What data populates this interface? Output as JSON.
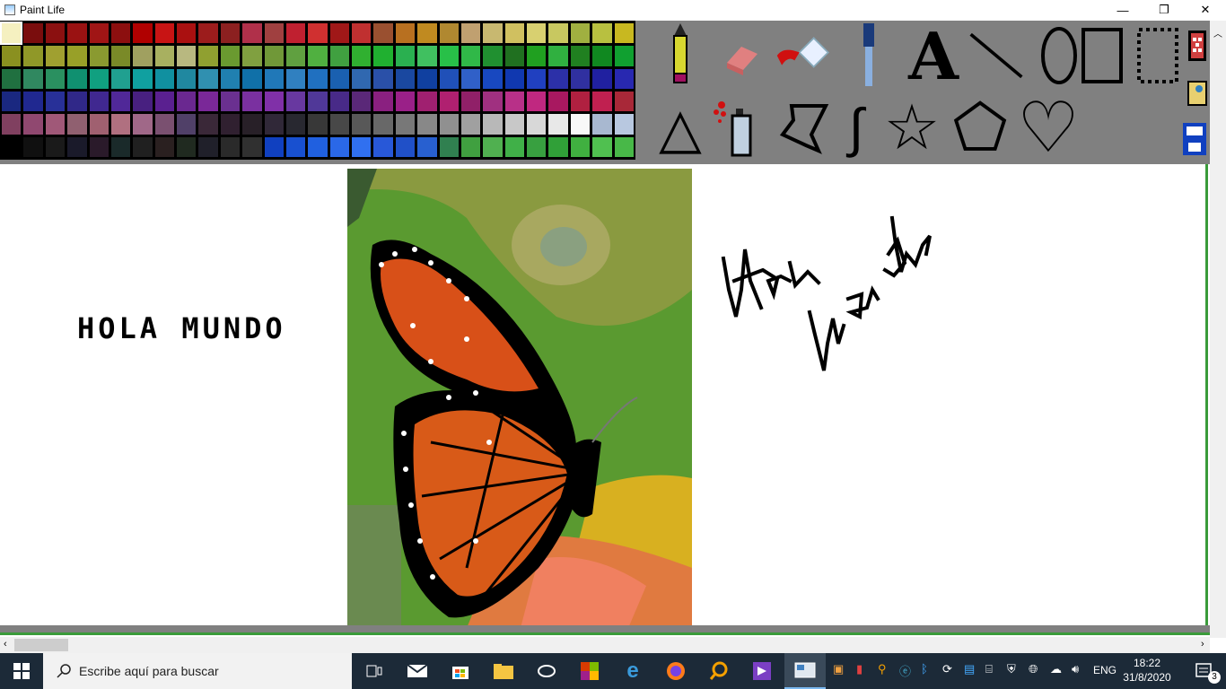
{
  "window": {
    "title": "Paint Life",
    "minimize_glyph": "—",
    "restore_glyph": "❐",
    "close_glyph": "✕"
  },
  "palette": {
    "colors": [
      "#f5f0c0",
      "#7a0d0d",
      "#8b1010",
      "#9a1212",
      "#a01515",
      "#8c0f0f",
      "#b00000",
      "#c81414",
      "#aa1010",
      "#9c1c1c",
      "#8c2020",
      "#b0304a",
      "#a04040",
      "#c02030",
      "#d03030",
      "#a01818",
      "#c03030",
      "#9a5030",
      "#b87020",
      "#c08a20",
      "#b08830",
      "#c0a070",
      "#c8b870",
      "#d0c060",
      "#d8d070",
      "#c8c860",
      "#a0b040",
      "#b8c040",
      "#c8b820",
      "#8a9020",
      "#909828",
      "#a0a030",
      "#98a028",
      "#8a9a30",
      "#7a8a28",
      "#a0a060",
      "#a8b060",
      "#b8b880",
      "#90a030",
      "#6a9a30",
      "#80a040",
      "#709838",
      "#60a040",
      "#50b040",
      "#40a040",
      "#30b030",
      "#20b030",
      "#2ab050",
      "#40c060",
      "#28c048",
      "#30b848",
      "#209030",
      "#207020",
      "#20a020",
      "#30b040",
      "#208020",
      "#108820",
      "#10a030",
      "#207040",
      "#308860",
      "#2a9060",
      "#109070",
      "#10a080",
      "#20a090",
      "#10a0a0",
      "#1090a0",
      "#2088a0",
      "#3090b0",
      "#2080b0",
      "#1070a8",
      "#2078b8",
      "#3080c0",
      "#2070c0",
      "#1a60b0",
      "#3068b0",
      "#2a50a8",
      "#1a48a0",
      "#1040a0",
      "#2050b8",
      "#3060c8",
      "#1848c0",
      "#1038b0",
      "#2040c0",
      "#2c30a8",
      "#3030a0",
      "#2020a0",
      "#2828b0",
      "#1a2880",
      "#202890",
      "#283098",
      "#302888",
      "#402890",
      "#502898",
      "#482080",
      "#5a2090",
      "#6a2890",
      "#7a2898",
      "#6a3090",
      "#7a30a0",
      "#8030a8",
      "#6838a0",
      "#503898",
      "#482a88",
      "#5a2878",
      "#8a2080",
      "#9a2088",
      "#a02070",
      "#b02070",
      "#902068",
      "#a03080",
      "#b83088",
      "#c02880",
      "#a81860",
      "#b02040",
      "#c02050",
      "#a82838",
      "#804060",
      "#904870",
      "#a05878",
      "#906070",
      "#a06070",
      "#b07080",
      "#a06888",
      "#7a5070",
      "#504068",
      "#3a2838",
      "#302030",
      "#282028",
      "#302838",
      "#282830",
      "#383838",
      "#484848",
      "#585858",
      "#686868",
      "#787878",
      "#888888",
      "#909090",
      "#a0a0a0",
      "#b8b8b8",
      "#c8c8c8",
      "#d8d8d8",
      "#e8e8e8",
      "#f8f8f8",
      "#a8b8d0",
      "#b8c8e0",
      "#000000",
      "#101010",
      "#1a1a1a",
      "#1a1a2a",
      "#2a1a2a",
      "#1a2a2a",
      "#202020",
      "#2a2020",
      "#202a20",
      "#20202a",
      "#2a2a2a",
      "#303030",
      "#1040c0",
      "#1850d0",
      "#2060e0",
      "#2a68e8",
      "#3070f0",
      "#2858d8",
      "#2050c8",
      "#2860d0",
      "#308050",
      "#40a040",
      "#50b050",
      "#40b048",
      "#38a040",
      "#30a038",
      "#40b040",
      "#50c050",
      "#48b848"
    ]
  },
  "tools": [
    {
      "name": "pencil-icon",
      "glyph": "✎"
    },
    {
      "name": "eraser-icon",
      "glyph": ""
    },
    {
      "name": "fill-bucket-icon",
      "glyph": ""
    },
    {
      "name": "eyedropper-icon",
      "glyph": ""
    },
    {
      "name": "text-tool-icon",
      "glyph": "A"
    },
    {
      "name": "line-tool-icon",
      "glyph": ""
    },
    {
      "name": "ellipse-tool-icon",
      "glyph": ""
    },
    {
      "name": "rectangle-tool-icon",
      "glyph": ""
    },
    {
      "name": "select-tool-icon",
      "glyph": ""
    },
    {
      "name": "triangle-tool-icon",
      "glyph": "△"
    },
    {
      "name": "spray-tool-icon",
      "glyph": ""
    },
    {
      "name": "polygon-tool-icon",
      "glyph": ""
    },
    {
      "name": "curve-tool-icon",
      "glyph": "∫"
    },
    {
      "name": "star-tool-icon",
      "glyph": "☆"
    },
    {
      "name": "pentagon-tool-icon",
      "glyph": "⬠"
    },
    {
      "name": "heart-tool-icon",
      "glyph": "♡"
    }
  ],
  "canvas": {
    "text_label": "HOLA MUNDO"
  },
  "taskbar": {
    "search_placeholder": "Escribe aquí para buscar",
    "language": "ENG",
    "time": "18:22",
    "date": "31/8/2020",
    "notifications": "3"
  }
}
